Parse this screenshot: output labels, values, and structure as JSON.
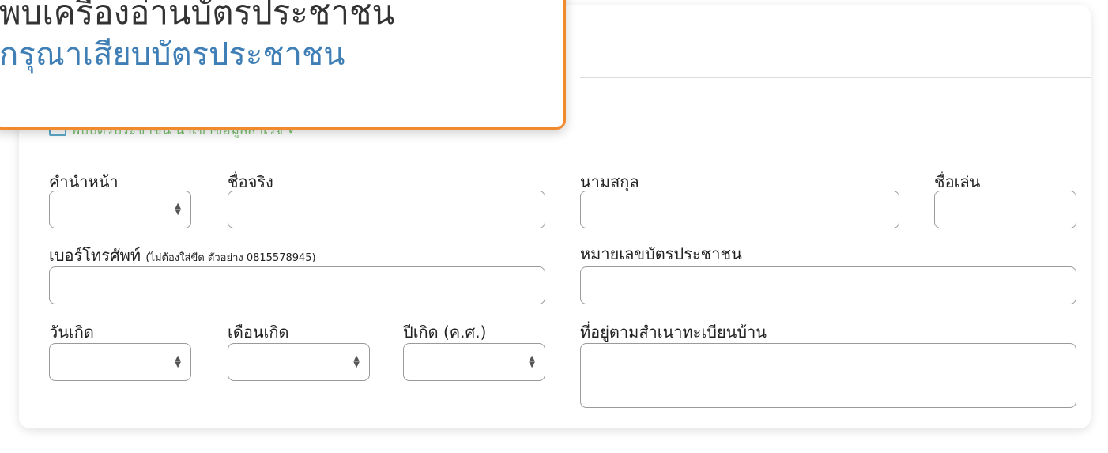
{
  "popup": {
    "title": "พบเครื่องอ่านบัตรประชาชน",
    "message": "กรุณาเสียบบัตรประชาชน"
  },
  "reader_status": "พบบัตรประชาชน นำเข้าข้อมูลสำเร็จ ✓",
  "form": {
    "prefix_label": "คำนำหน้า",
    "firstname_label": "ชื่อจริง",
    "lastname_label": "นามสกุล",
    "nickname_label": "ชื่อเล่น",
    "phone_label": "เบอร์โทรศัพท์",
    "phone_hint": "(ไม่ต้องใส่ขีด ตัวอย่าง 0815578945)",
    "idcard_label": "หมายเลขบัตรประชาชน",
    "birthday_label": "วันเกิด",
    "birthmonth_label": "เดือนเกิด",
    "birthyear_label": "ปีเกิด (ค.ศ.)",
    "address_label": "ที่อยู่ตามสำเนาทะเบียนบ้าน"
  }
}
